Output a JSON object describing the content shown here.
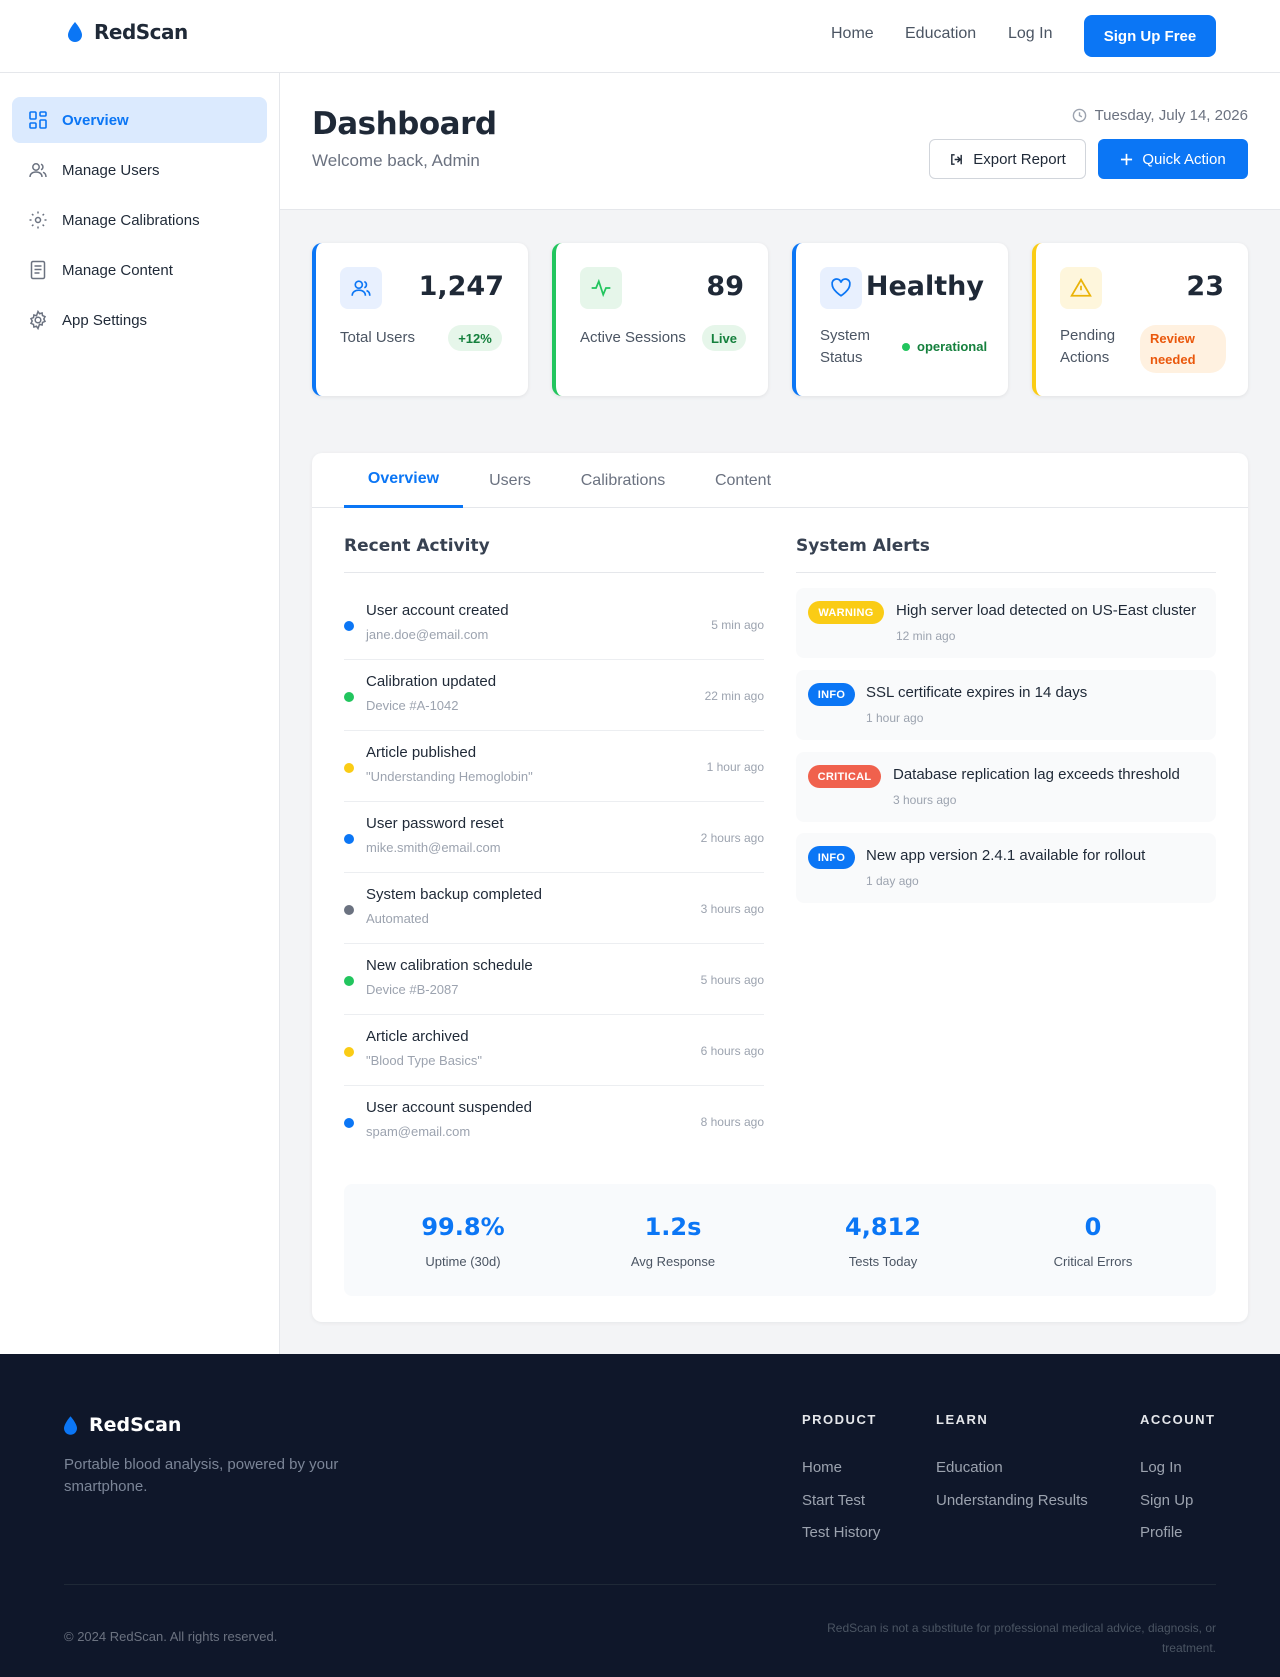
{
  "brand": {
    "name": "RedScan",
    "accent": "#0b76f5"
  },
  "topnav": {
    "links": [
      "Home",
      "Education",
      "Log In"
    ],
    "cta": "Sign Up Free"
  },
  "sidebar": {
    "items": [
      {
        "label": "Overview",
        "icon": "grid-icon",
        "active": true
      },
      {
        "label": "Manage Users",
        "icon": "users-icon"
      },
      {
        "label": "Manage Calibrations",
        "icon": "sun-icon"
      },
      {
        "label": "Manage Content",
        "icon": "document-icon"
      },
      {
        "label": "App Settings",
        "icon": "gear-icon"
      }
    ]
  },
  "header": {
    "title": "Dashboard",
    "subtitle": "Welcome back, Admin",
    "date": "Tuesday, July 14, 2026",
    "export_label": "Export Report",
    "quick_label": "Quick Action"
  },
  "stats": [
    {
      "value": "1,247",
      "label": "Total Users",
      "pill": "+12%",
      "color": "#0b76f5",
      "icon": "users-icon"
    },
    {
      "value": "89",
      "label": "Active Sessions",
      "pill": "Live",
      "color": "#22c55e",
      "icon": "activity-icon"
    },
    {
      "value": "Healthy",
      "label_line1": "System",
      "label_line2": "Status",
      "status": "operational",
      "color": "#0b76f5",
      "icon": "heart-icon"
    },
    {
      "value": "23",
      "label_line1": "Pending",
      "label_line2": "Actions",
      "pill_line1": "Review",
      "pill_line2": "needed",
      "color": "#facc15",
      "icon": "warning-icon"
    }
  ],
  "tabs": [
    "Overview",
    "Users",
    "Calibrations",
    "Content"
  ],
  "activity": {
    "title": "Recent Activity",
    "items": [
      {
        "title": "User account created",
        "sub": "jane.doe@email.com",
        "time": "5 min ago",
        "color": "#0b76f5"
      },
      {
        "title": "Calibration updated",
        "sub": "Device #A-1042",
        "time": "22 min ago",
        "color": "#22c55e"
      },
      {
        "title": "Article published",
        "sub": "\"Understanding Hemoglobin\"",
        "time": "1 hour ago",
        "color": "#facc15"
      },
      {
        "title": "User password reset",
        "sub": "mike.smith@email.com",
        "time": "2 hours ago",
        "color": "#0b76f5"
      },
      {
        "title": "System backup completed",
        "sub": "Automated",
        "time": "3 hours ago",
        "color": "#6b7280"
      },
      {
        "title": "New calibration schedule",
        "sub": "Device #B-2087",
        "time": "5 hours ago",
        "color": "#22c55e"
      },
      {
        "title": "Article archived",
        "sub": "\"Blood Type Basics\"",
        "time": "6 hours ago",
        "color": "#facc15"
      },
      {
        "title": "User account suspended",
        "sub": "spam@email.com",
        "time": "8 hours ago",
        "color": "#0b76f5"
      }
    ]
  },
  "alerts": {
    "title": "System Alerts",
    "items": [
      {
        "badge": "WARNING",
        "title": "High server load detected on US-East cluster",
        "time": "12 min ago",
        "color": "#facc15"
      },
      {
        "badge": "INFO",
        "title": "SSL certificate expires in 14 days",
        "time": "1 hour ago",
        "color": "#0b76f5"
      },
      {
        "badge": "CRITICAL",
        "title": "Database replication lag exceeds threshold",
        "time": "3 hours ago",
        "color": "#f0614d"
      },
      {
        "badge": "INFO",
        "title": "New app version 2.4.1 available for rollout",
        "time": "1 day ago",
        "color": "#0b76f5"
      }
    ]
  },
  "metrics": [
    {
      "value": "99.8%",
      "label": "Uptime (30d)"
    },
    {
      "value": "1.2s",
      "label": "Avg Response"
    },
    {
      "value": "4,812",
      "label": "Tests Today"
    },
    {
      "value": "0",
      "label": "Critical Errors"
    }
  ],
  "footer": {
    "tagline": "Portable blood analysis, powered by your smartphone.",
    "columns": [
      {
        "heading": "PRODUCT",
        "links": [
          "Home",
          "Start Test",
          "Test History"
        ]
      },
      {
        "heading": "LEARN",
        "links": [
          "Education",
          "Understanding Results"
        ]
      },
      {
        "heading": "ACCOUNT",
        "links": [
          "Log In",
          "Sign Up",
          "Profile"
        ]
      }
    ],
    "copyright": "© 2024 RedScan. All rights reserved.",
    "disclaimer": "RedScan is not a substitute for professional medical advice, diagnosis, or treatment."
  }
}
